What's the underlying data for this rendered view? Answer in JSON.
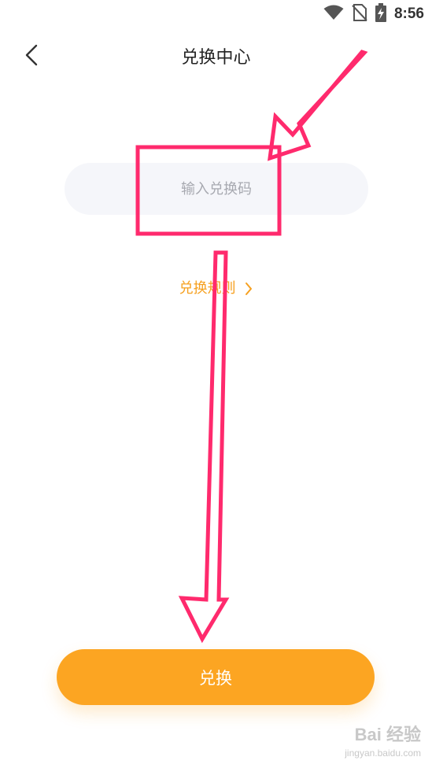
{
  "status_bar": {
    "time": "8:56",
    "icons": [
      "wifi-icon",
      "no-sim-icon",
      "battery-charging-icon"
    ]
  },
  "nav": {
    "title": "兑换中心",
    "back_icon": "chevron-left-icon"
  },
  "redeem_form": {
    "code_placeholder": "输入兑换码",
    "code_value": "",
    "rules_link": "兑换规则",
    "submit_label": "兑换"
  },
  "watermark": {
    "brand": "Bai 经验",
    "url": "jingyan.baidu.com"
  },
  "colors": {
    "accent": "#fca522",
    "link": "#f6a01f",
    "annotation": "#ff2a6d",
    "input_bg": "#f5f6fa"
  }
}
